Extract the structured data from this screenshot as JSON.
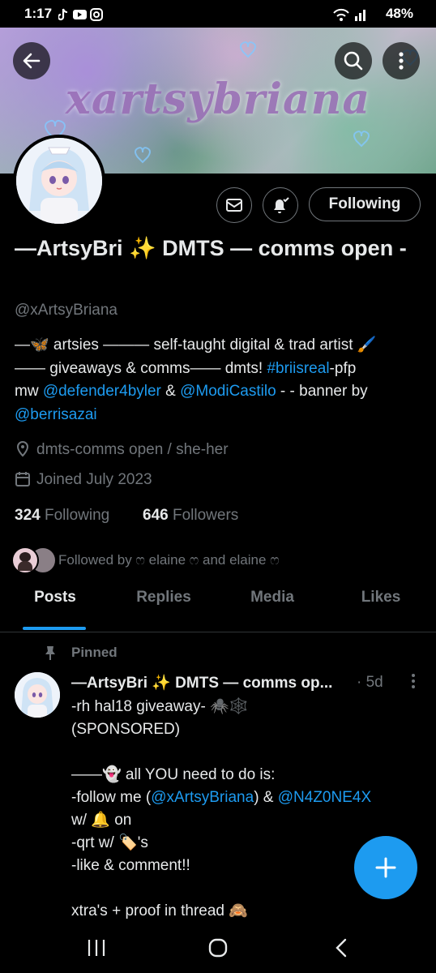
{
  "status_bar": {
    "time": "1:17",
    "battery": "48%"
  },
  "banner": {
    "text": "xartsybriana"
  },
  "profile": {
    "following_button": "Following",
    "display_name": "—ArtsyBri ✨ DMTS — comms open -",
    "handle": "@xArtsyBriana",
    "bio": {
      "line1_pre": "—🦋 artsies ——— self-taught digital & trad artist 🖌️",
      "line2_pre": "—— giveaways & comms—— dmts! ",
      "hashtag": "#briisreal",
      "line2_post": "-pfp",
      "line3_pre": "mw ",
      "mention1": "@defender4byler",
      "mid": " & ",
      "mention2": "@ModiCastilo",
      "line3_post": " - - banner by",
      "mention3": "@berrisazai"
    },
    "location": "dmts-comms open / she-her",
    "joined": "Joined July 2023",
    "following_count": "324",
    "following_label": "Following",
    "followers_count": "646",
    "followers_label": "Followers",
    "followed_by": "Followed by ෆ elaine ෆ and elaine ෆ"
  },
  "tabs": [
    "Posts",
    "Replies",
    "Media",
    "Likes"
  ],
  "active_tab": "Posts",
  "post": {
    "pinned_label": "Pinned",
    "author": "—ArtsyBri ✨ DMTS — comms op...",
    "time": "· 5d",
    "line1": "-rh hal18 giveaway- 🕷️🕸️",
    "line2": "(SPONSORED)",
    "line3": "——👻 all YOU need to do is:",
    "line4_pre": "-follow me (",
    "line4_mention1": "@xArtsyBriana",
    "line4_mid": ") & ",
    "line4_mention2": "@N4Z0NE4X",
    "line5": "w/ 🔔 on",
    "line6": "-qrt w/ 🏷️'s",
    "line7": "-like & comment!!",
    "line8": "xtra's + proof in thread 🙈"
  },
  "colors": {
    "accent": "#1d9bf0",
    "muted": "#71767b",
    "text": "#e7e9ea",
    "bg": "#000000"
  }
}
